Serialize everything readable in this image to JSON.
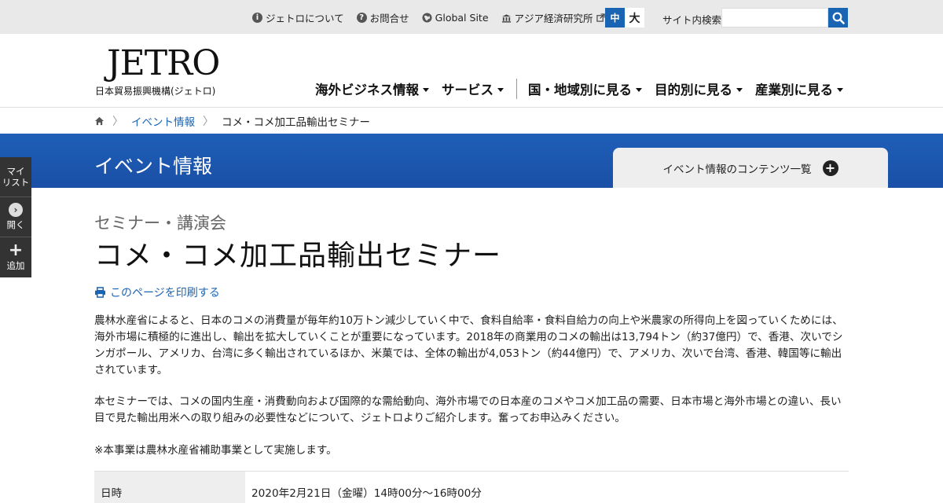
{
  "utility": {
    "links": [
      {
        "icon": "info-icon",
        "label": "ジェトロについて"
      },
      {
        "icon": "help-icon",
        "label": "お問合せ"
      },
      {
        "icon": "globe-icon",
        "label": "Global Site"
      },
      {
        "icon": "building-icon",
        "label": "アジア経済研究所"
      }
    ],
    "font_size_mid": "中",
    "font_size_large": "大",
    "search_label": "サイト内検索",
    "search_value": ""
  },
  "header": {
    "logo_text": "JETRO",
    "logo_subtitle": "日本貿易振興機構(ジェトロ)",
    "nav": [
      {
        "label": "海外ビジネス情報"
      },
      {
        "label": "サービス"
      },
      {
        "label": "国・地域別に見る"
      },
      {
        "label": "目的別に見る"
      },
      {
        "label": "産業別に見る"
      }
    ]
  },
  "breadcrumb": {
    "items": [
      "イベント情報",
      "コメ・コメ加工品輸出セミナー"
    ]
  },
  "band": {
    "title": "イベント情報",
    "contents_label": "イベント情報のコンテンツ一覧"
  },
  "side_tools": {
    "mylist": "マイ\nリスト",
    "open": "開く",
    "add": "追加"
  },
  "main": {
    "category": "セミナー・講演会",
    "title": "コメ・コメ加工品輸出セミナー",
    "print_label": "このページを印刷する",
    "paragraphs": [
      "農林水産省によると、日本のコメの消費量が毎年約10万トン減少していく中で、食料自給率・食料自給力の向上や米農家の所得向上を図っていくためには、海外市場に積極的に進出し、輸出を拡大していくことが重要になっています。2018年の商業用のコメの輸出は13,794トン（約37億円）で、香港、次いでシンガポール、アメリカ、台湾に多く輸出されているほか、米菓では、全体の輸出が4,053トン（約44億円）で、アメリカ、次いで台湾、香港、韓国等に輸出されています。",
      "本セミナーでは、コメの国内生産・消費動向および国際的な需給動向、海外市場での日本産のコメやコメ加工品の需要、日本市場と海外市場との違い、長い目で見た輸出用米への取り組みの必要性などについて、ジェトロよりご紹介します。奮ってお申込みください。",
      "※本事業は農林水産省補助事業として実施します。"
    ],
    "table": [
      {
        "label": "日時",
        "value": "2020年2月21日（金曜）14時00分～16時00分"
      }
    ]
  },
  "colors": {
    "accent": "#1a64b4",
    "band": "#1f5fb8"
  }
}
